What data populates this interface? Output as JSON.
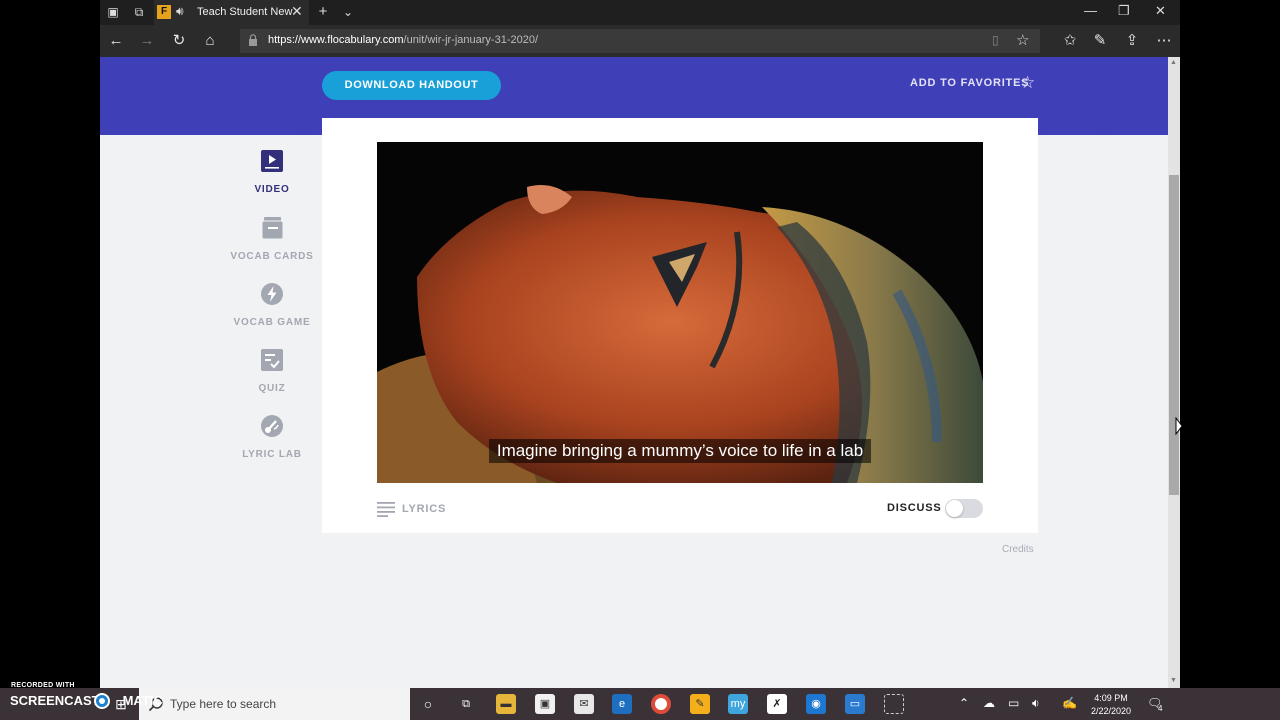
{
  "browser": {
    "tab_title": "Teach Student New",
    "tab_favicon": "F",
    "url_domain": "https://www.flocabulary.com",
    "url_path": "/unit/wir-jr-january-31-2020/"
  },
  "header": {
    "download_label": "DOWNLOAD HANDOUT",
    "favorites_label": "ADD TO FAVORITES"
  },
  "sidebar": {
    "items": [
      {
        "label": "VIDEO",
        "icon": "video-play-icon"
      },
      {
        "label": "VOCAB CARDS",
        "icon": "vocab-cards-icon"
      },
      {
        "label": "VOCAB GAME",
        "icon": "lightning-bolt-icon"
      },
      {
        "label": "QUIZ",
        "icon": "quiz-checklist-icon"
      },
      {
        "label": "LYRIC LAB",
        "icon": "lyric-lab-icon"
      }
    ]
  },
  "video": {
    "caption": "Imagine bringing a mummy’s voice to life in a lab"
  },
  "card": {
    "lyrics_label": "LYRICS",
    "discuss_label": "DISCUSS",
    "credits_label": "Credits"
  },
  "taskbar": {
    "search_placeholder": "Type here to search",
    "time": "4:09 PM",
    "date": "2/22/2020",
    "notification_count": "4",
    "my_label": "my"
  },
  "watermark": {
    "line1": "RECORDED WITH",
    "line2": "SCREENCAST",
    "line3": "MATIC"
  },
  "colors": {
    "hero": "#3f3fb8",
    "download_button": "#1aa0d8",
    "active_nav": "#32307a",
    "inactive_nav": "#a3a7b1"
  }
}
